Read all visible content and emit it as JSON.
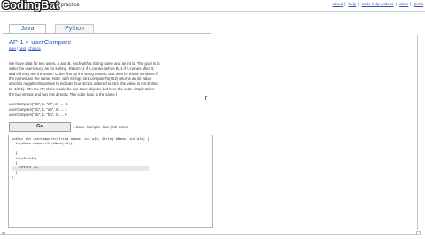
{
  "header": {
    "logo": "CodingBat",
    "tagline": "code practice",
    "links": [
      "about",
      "help",
      "code help+videos",
      "done",
      "prefs"
    ]
  },
  "tabs": [
    {
      "label": "Java",
      "active": true
    },
    {
      "label": "Python",
      "active": false
    }
  ],
  "problem": {
    "title": "AP-1 > userCompare",
    "nav": {
      "prev": "prev",
      "next": "next",
      "chance": "chance"
    },
    "description": [
      "We have data for two users, A and B, each with a String name and an int id. The goal is to",
      "order the users such as for sorting. Return -1 if A comes before B, 1 if A comes after B,",
      "and 0 if they are the same. Order first by the string names, and then by the id numbers if",
      "the names are the same. Note: with Strings str1.compareTo(str2) returns an int value",
      "which is negative/0/positive to indicate how str1 is ordered to str2 (the value is not limited",
      "to -1/0/1). (On the AP, there would be two User objects, but here the code simply takes",
      "the two strings and two ints directly. The code logic is the same.)"
    ],
    "examples": [
      "userCompare(\"bb\", 1, \"zz\", 2) → -1",
      "userCompare(\"bb\", 1, \"aa\", 2) → 1",
      "userCompare(\"bb\", 1, \"bb\", 1) → 0"
    ]
  },
  "go": {
    "label": "Go",
    "hint": "...Save, Compile, Run (ctrl-enter)"
  },
  "code_lines": [
    "public int userCompare(String aName, int aId, String bName, int bId) {",
    "  if(aName.compareTo(bName)<0){",
    "    ",
    "  }",
    "  if(aId>bId)",
    "  {",
    "    return -1;",
    "  }",
    "}"
  ]
}
